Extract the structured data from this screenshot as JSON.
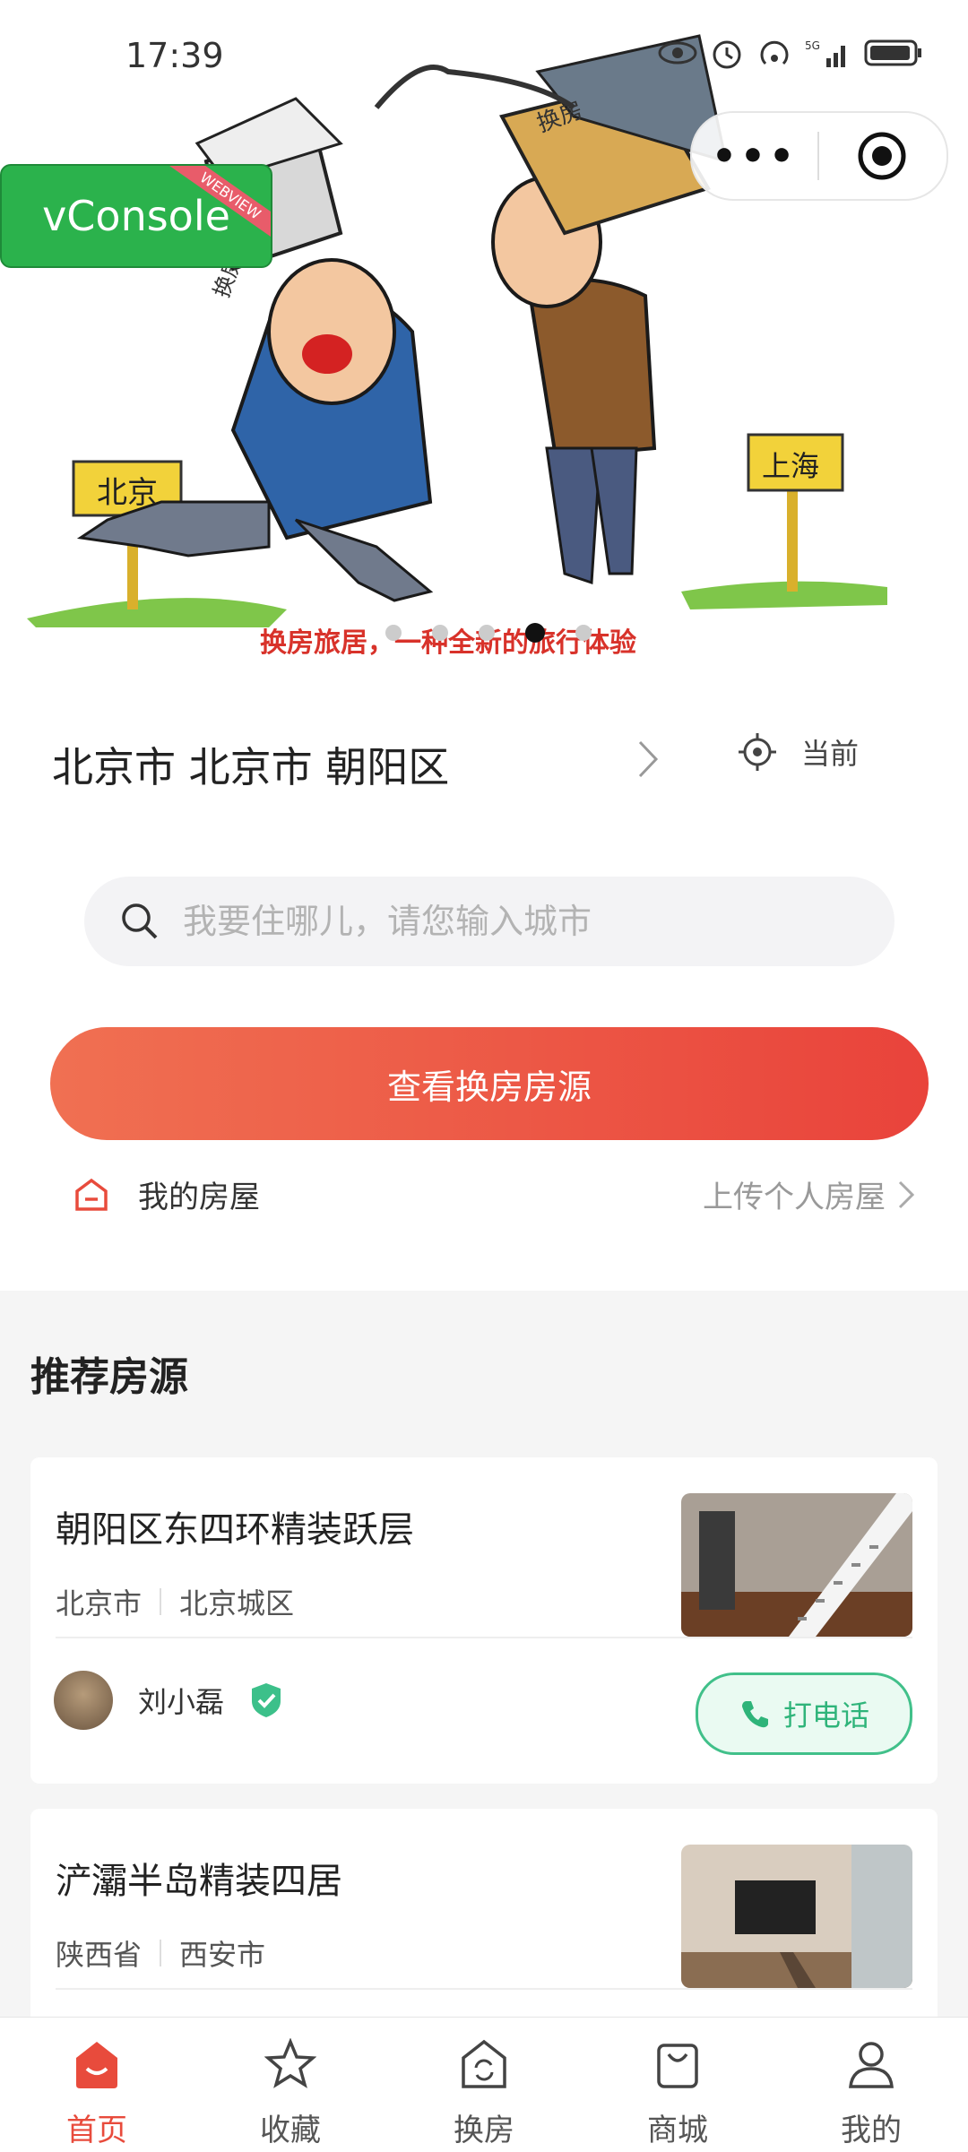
{
  "status_bar": {
    "time": "17:39"
  },
  "banner": {
    "sign_left": "北京",
    "sign_right": "上海",
    "house_left": "换房",
    "house_right": "换房",
    "slogan": "换房旅居，一种全新的旅行体验",
    "active_dot": 3
  },
  "vconsole": {
    "label": "vConsole",
    "ribbon": "WEBVIEW"
  },
  "location": {
    "text": "北京市 北京市 朝阳区",
    "current_label": "当前"
  },
  "search": {
    "placeholder": "我要住哪儿，请您输入城市"
  },
  "cta": {
    "label": "查看换房房源"
  },
  "my_house": {
    "label": "我的房屋",
    "upload_label": "上传个人房屋"
  },
  "recommend": {
    "title": "推荐房源",
    "items": [
      {
        "title": "朝阳区东四环精装跃层",
        "province": "北京市",
        "city": "北京城区",
        "owner": "刘小磊",
        "call_label": "打电话"
      },
      {
        "title": "浐灞半岛精装四居",
        "province": "陕西省",
        "city": "西安市"
      }
    ]
  },
  "tabbar": {
    "items": [
      {
        "label": "首页",
        "icon": "home-icon",
        "active": true
      },
      {
        "label": "收藏",
        "icon": "star-icon"
      },
      {
        "label": "换房",
        "icon": "swap-house-icon"
      },
      {
        "label": "商城",
        "icon": "shopping-bag-icon"
      },
      {
        "label": "我的",
        "icon": "user-icon"
      }
    ]
  },
  "colors": {
    "accent": "#e84b3c",
    "call_green": "#2fb47a",
    "vconsole_green": "#2bb24c"
  }
}
